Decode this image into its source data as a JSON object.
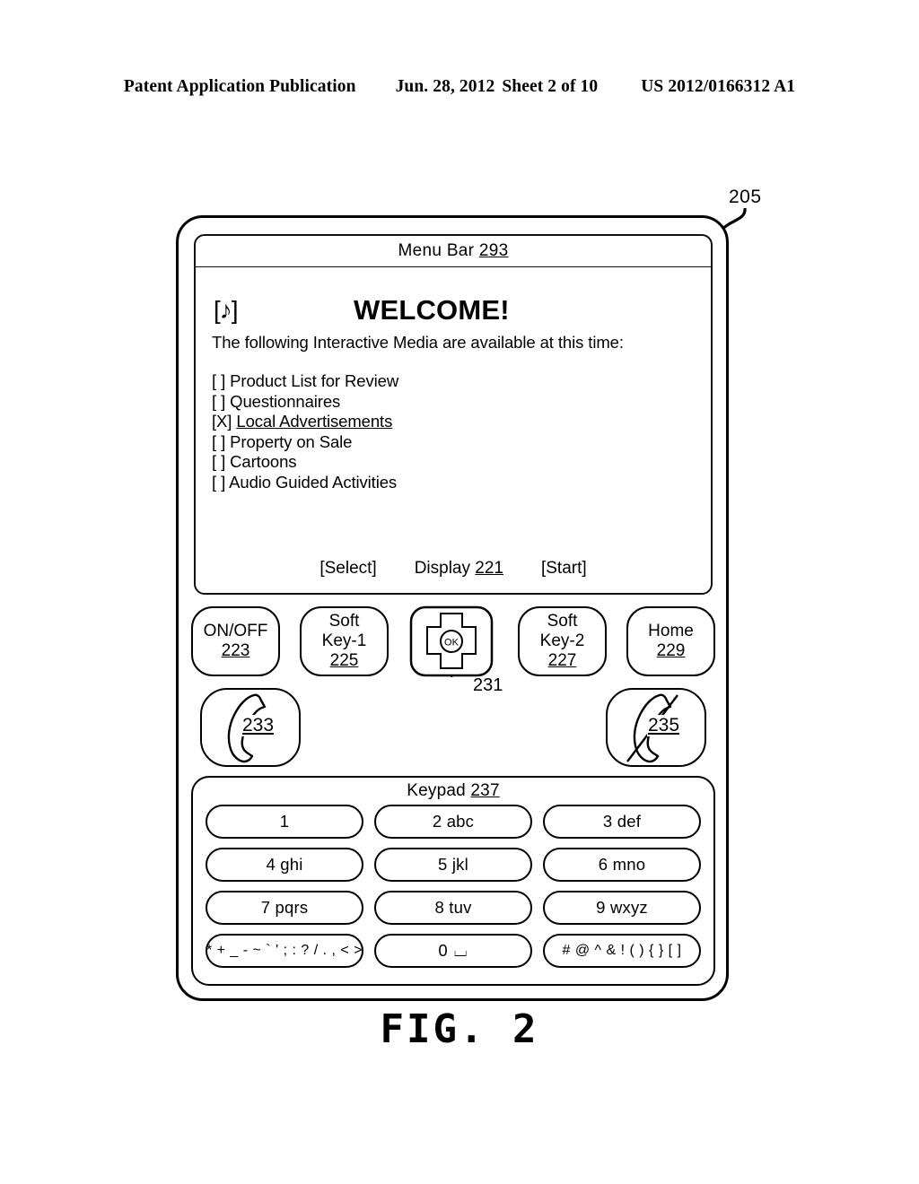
{
  "header": {
    "publication": "Patent Application Publication",
    "date": "Jun. 28, 2012",
    "sheet": "Sheet 2 of 10",
    "patent_number": "US 2012/0166312 A1"
  },
  "figure": {
    "caption": "FIG. 2",
    "device_ref": "205"
  },
  "device": {
    "screen": {
      "menu_bar_label": "Menu Bar ",
      "menu_bar_ref": "293",
      "note_icon": "[♪]",
      "welcome_title": "WELCOME!",
      "welcome_subtitle": "The following Interactive Media are available at this time:",
      "media_items": [
        {
          "checkbox": "[ ]",
          "label": "Product List for Review",
          "selected": false
        },
        {
          "checkbox": "[ ]",
          "label": "Questionnaires",
          "selected": false
        },
        {
          "checkbox": "[X]",
          "label": "Local Advertisements",
          "selected": true
        },
        {
          "checkbox": "[ ]",
          "label": "Property on Sale",
          "selected": false
        },
        {
          "checkbox": "[ ]",
          "label": "Cartoons",
          "selected": false
        },
        {
          "checkbox": "[ ]",
          "label": "Audio Guided Activities",
          "selected": false
        }
      ],
      "footer": {
        "select": "[Select]",
        "display_label": "Display ",
        "display_ref": "221",
        "start": "[Start]"
      }
    },
    "controls": [
      {
        "label": "ON/OFF",
        "ref": "223"
      },
      {
        "label_line1": "Soft",
        "label_line2": "Key-1",
        "ref": "225"
      },
      {
        "label": "OK",
        "ref": "231"
      },
      {
        "label_line1": "Soft",
        "label_line2": "Key-2",
        "ref": "227"
      },
      {
        "label": "Home",
        "ref": "229"
      }
    ],
    "call_buttons": {
      "send_ref": "233",
      "end_ref": "235"
    },
    "keypad": {
      "title_label": "Keypad ",
      "title_ref": "237",
      "keys": [
        "1",
        "2 abc",
        "3 def",
        "4 ghi",
        "5 jkl",
        "6 mno",
        "7 pqrs",
        "8 tuv",
        "9 wxyz",
        "* + _ - ~ ` ' ; : ? / . , < >",
        "0 ⌴",
        "# @ ^ & ! ( ) { } [ ]"
      ]
    }
  }
}
